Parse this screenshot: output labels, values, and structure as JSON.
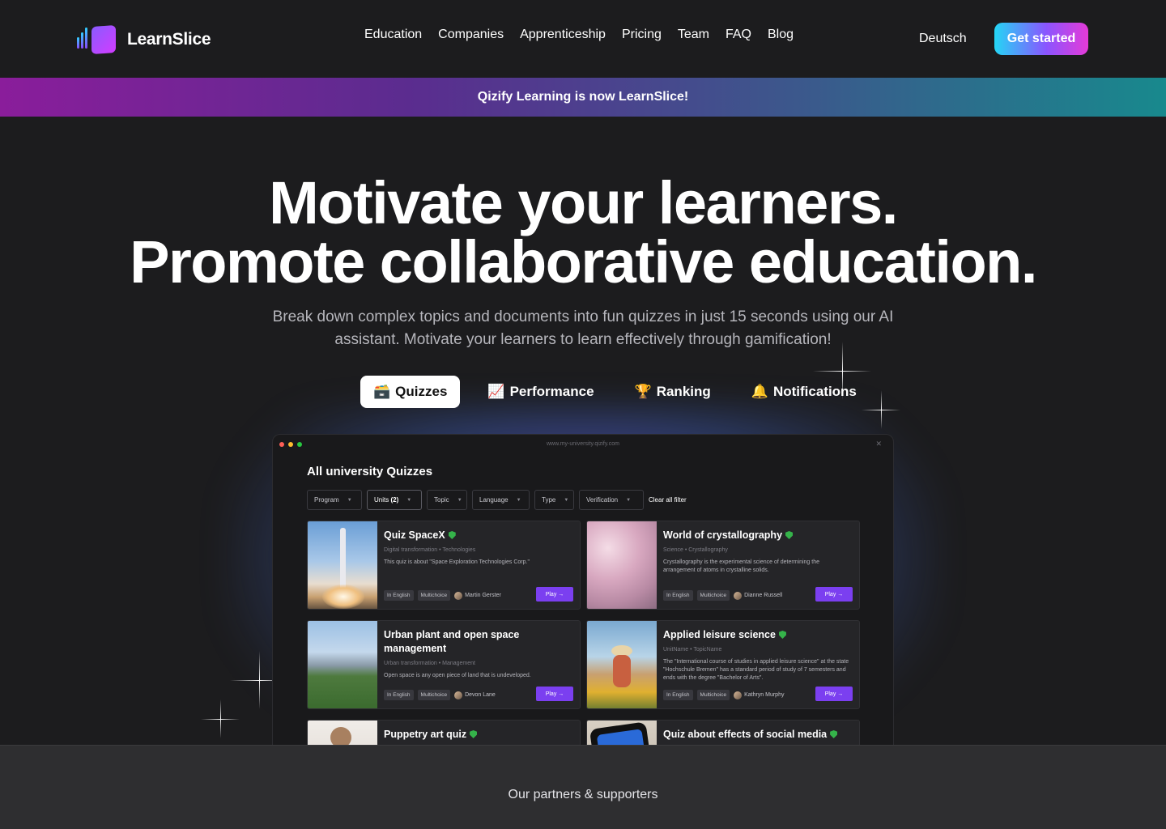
{
  "brand": {
    "name": "LearnSlice"
  },
  "nav": {
    "links": [
      "Education",
      "Companies",
      "Apprenticeship",
      "Pricing",
      "Team",
      "FAQ",
      "Blog"
    ],
    "language": "Deutsch",
    "cta": "Get started"
  },
  "announcement": "Qizify Learning is now LearnSlice!",
  "hero": {
    "line1": "Motivate your learners.",
    "line2": "Promote collaborative education.",
    "subtitle": "Break down complex topics and documents into fun quizzes in just 15 seconds using our AI assistant. Motivate your learners to learn effectively through gamification!"
  },
  "tabs": [
    {
      "emoji": "🗃️",
      "label": "Quizzes",
      "active": true
    },
    {
      "emoji": "📈",
      "label": "Performance",
      "active": false
    },
    {
      "emoji": "🏆",
      "label": "Ranking",
      "active": false
    },
    {
      "emoji": "🔔",
      "label": "Notifications",
      "active": false
    }
  ],
  "app": {
    "url": "www.my-university.qizify.com",
    "title": "All university Quizzes",
    "filters": [
      {
        "label": "Program",
        "selected": false
      },
      {
        "label": "Units",
        "count": "(2)",
        "selected": true
      },
      {
        "label": "Topic",
        "selected": false
      },
      {
        "label": "Language",
        "selected": false
      },
      {
        "label": "Type",
        "selected": false
      },
      {
        "label": "Verification",
        "selected": false
      }
    ],
    "clear_filters": "Clear all filter",
    "play_label": "Play",
    "quizzes": [
      {
        "title": "Quiz SpaceX",
        "category": "Digital transformation",
        "topic": "Technologies",
        "description": "This quiz is about \"Space Exploration Technologies Corp.\"",
        "language": "In English",
        "type": "Multichoice",
        "author": "Martin Gerster"
      },
      {
        "title": "World of crystallography",
        "category": "Science",
        "topic": "Crystallography",
        "description": "Crystallography is the experimental science of determining the arrangement of atoms in crystalline solids.",
        "language": "In English",
        "type": "Multichoice",
        "author": "Dianne Russell"
      },
      {
        "title": "Urban plant and open space management",
        "category": "Urban transformation",
        "topic": "Management",
        "description": "Open space is any open piece of land that is undeveloped.",
        "language": "In English",
        "type": "Multichoice",
        "author": "Devon Lane"
      },
      {
        "title": "Applied leisure science",
        "category": "UnitName",
        "topic": "TopicName",
        "description": "The \"International course of studies in applied leisure science\" at the state \"Hochschule Bremen\" has a standard period of study of 7 semesters and ends with the degree \"Bachelor of Arts\".",
        "language": "In English",
        "type": "Multichoice",
        "author": "Kathryn Murphy"
      },
      {
        "title": "Puppetry art quiz"
      },
      {
        "title": "Quiz about effects of social media"
      }
    ]
  },
  "partners": {
    "title": "Our partners & supporters"
  },
  "colors": {
    "accent": "#7b3ff0",
    "verified": "#35b34a",
    "background": "#1c1c1e"
  }
}
